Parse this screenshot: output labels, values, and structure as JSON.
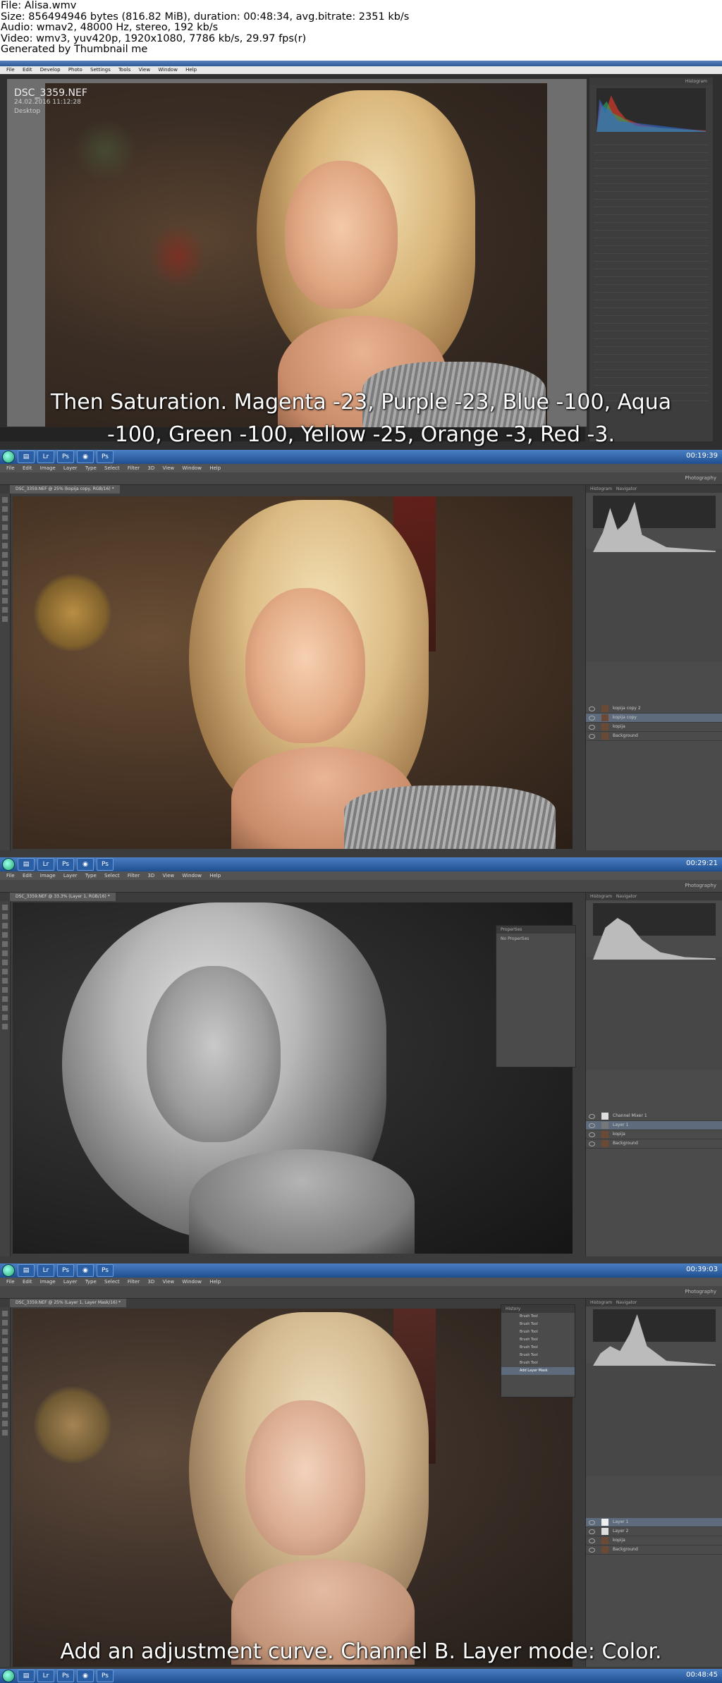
{
  "header": {
    "file": "File: Alisa.wmv",
    "size": "Size: 856494946 bytes (816.82 MiB), duration: 00:48:34, avg.bitrate: 2351 kb/s",
    "audio": "Audio: wmav2, 48000 Hz, stereo, 192 kb/s",
    "video": "Video: wmv3, yuv420p, 1920x1080, 7786 kb/s, 29.97 fps(r)",
    "generated": "Generated by Thumbnail me"
  },
  "frame1": {
    "app": "Adobe Photoshop Lightroom",
    "menu": [
      "File",
      "Edit",
      "Develop",
      "Photo",
      "Settings",
      "Tools",
      "View",
      "Window",
      "Help"
    ],
    "image_info": {
      "filename": "DSC_3359.NEF",
      "date": "24.02.2016 11:12:28",
      "folder": "Desktop"
    },
    "panel_title": "Histogram",
    "caption_line1": "Then Saturation. Magenta -23, Purple -23, Blue -100, Aqua",
    "caption_line2": "-100, Green -100, Yellow -25, Orange -3, Red -3."
  },
  "frame2": {
    "timestamp": "00:19:39",
    "menu": [
      "File",
      "Edit",
      "Image",
      "Layer",
      "Type",
      "Select",
      "Filter",
      "3D",
      "View",
      "Window",
      "Help"
    ],
    "doc_tab": "DSC_3359.NEF @ 25% (kopija copy, RGB/16) *",
    "workspace": "Photography",
    "layers": [
      "kopija copy 2",
      "kopija copy",
      "kopija",
      "Background"
    ],
    "panel_tabs": [
      "Histogram",
      "Navigator"
    ]
  },
  "frame3": {
    "timestamp": "00:29:21",
    "doc_tab": "DSC_3359.NEF @ 33.3% (Layer 1, RGB/16) *",
    "properties_title": "Properties",
    "properties_text": "No Properties",
    "layers": [
      "Channel Mixer 1",
      "Layer 1",
      "kopija",
      "Background"
    ]
  },
  "frame4": {
    "timestamp": "00:39:03",
    "end_timestamp": "00:48:45",
    "doc_tab": "DSC_3359.NEF @ 25% (Layer 1, Layer Mask/16) *",
    "history_title": "History",
    "history_items": [
      "Brush Tool",
      "Brush Tool",
      "Brush Tool",
      "Brush Tool",
      "Brush Tool",
      "Brush Tool",
      "Brush Tool",
      "Add Layer Mask"
    ],
    "layers": [
      "Layer 1",
      "Layer 2",
      "kopija",
      "Background"
    ],
    "caption": "Add an adjustment curve. Channel B. Layer mode: Color."
  },
  "colors": {
    "taskbar": "#2b5fa5",
    "ps_panel": "#4b4b4b",
    "ps_canvas": "#3c3c3c",
    "caption_text": "#ffffff"
  }
}
